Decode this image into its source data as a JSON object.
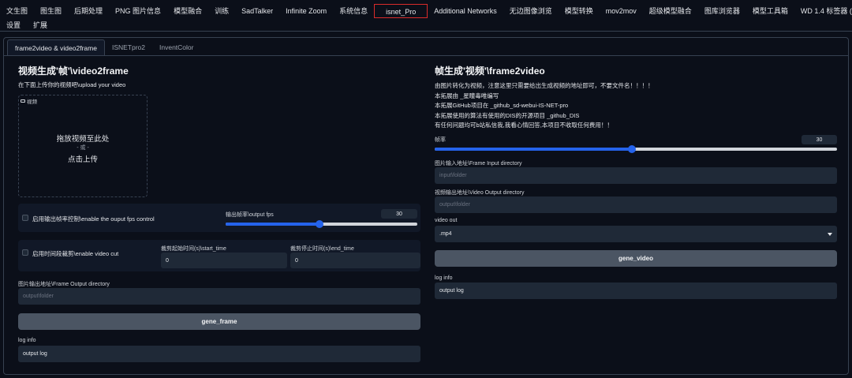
{
  "topnav": {
    "tabs": [
      "文生图",
      "图生图",
      "后期处理",
      "PNG 图片信息",
      "模型融合",
      "训练",
      "SadTalker",
      "Infinite Zoom",
      "系统信息",
      "isnet_Pro",
      "Additional Networks",
      "无边图像浏览",
      "模型转换",
      "mov2mov",
      "超级模型融合",
      "图库浏览器",
      "模型工具箱",
      "WD 1.4 标签器 (Tagger)"
    ],
    "tabs_row2": [
      "设置",
      "扩展"
    ],
    "active": "isnet_Pro"
  },
  "subtabs": [
    "frame2video & video2frame",
    "ISNETpro2",
    "InventColor"
  ],
  "left": {
    "title": "视频生成'帧'\\video2frame",
    "subtitle": "在下面上传你的视频吧\\upload your video",
    "upload": {
      "tag": "视频",
      "drop": "拖放视频至此处",
      "or": "- 或 -",
      "click": "点击上传"
    },
    "fps_checkbox": "启用输出帧率控制\\enable the ouput fps control",
    "fps_label": "输出帧率\\output fps",
    "fps_value": "30",
    "fps_fraction": 0.49,
    "cut_checkbox": "启用时间段裁剪\\enable video cut",
    "start_label": "裁剪起始时间(s)\\start_time",
    "start_value": "0",
    "end_label": "裁剪停止时间(s)\\end_time",
    "end_value": "0",
    "out_dir_label": "图片输出地址\\Frame Output directory",
    "out_dir_placeholder": "output\\folder",
    "button": "gene_frame",
    "log_label": "log info",
    "log_value": "output log"
  },
  "right": {
    "title": "帧生成'视频'\\frame2video",
    "lines": [
      "由图片转化为视频，注意这里只需要给出生成视频的地址即可，不要文件名！！！！",
      "本拓展由 _星瞳毒唯编写",
      "本拓展GitHub项目在 _github_sd-webui-IS-NET-pro",
      "本拓展使用的算法有使用的DIS的开源项目 _github_DIS",
      "有任何问题均可b站私信我,我看心情回答,本项目不收取任何费用！！"
    ],
    "fps_label": "帧率",
    "fps_value": "30",
    "fps_fraction": 0.49,
    "in_dir_label": "图片输入地址\\Frame Input directory",
    "in_dir_placeholder": "input\\folder",
    "out_dir_label": "视频输出地址\\Video Output directory",
    "out_dir_placeholder": "output\\folder",
    "video_out_label": "video out",
    "video_out_value": ".mp4",
    "button": "gene_video",
    "log_label": "log info",
    "log_value": "output log"
  },
  "colors": {
    "accent": "#2563eb",
    "active_tab_border": "#d92b2b",
    "bg": "#0b0f19",
    "panel": "#111827"
  }
}
